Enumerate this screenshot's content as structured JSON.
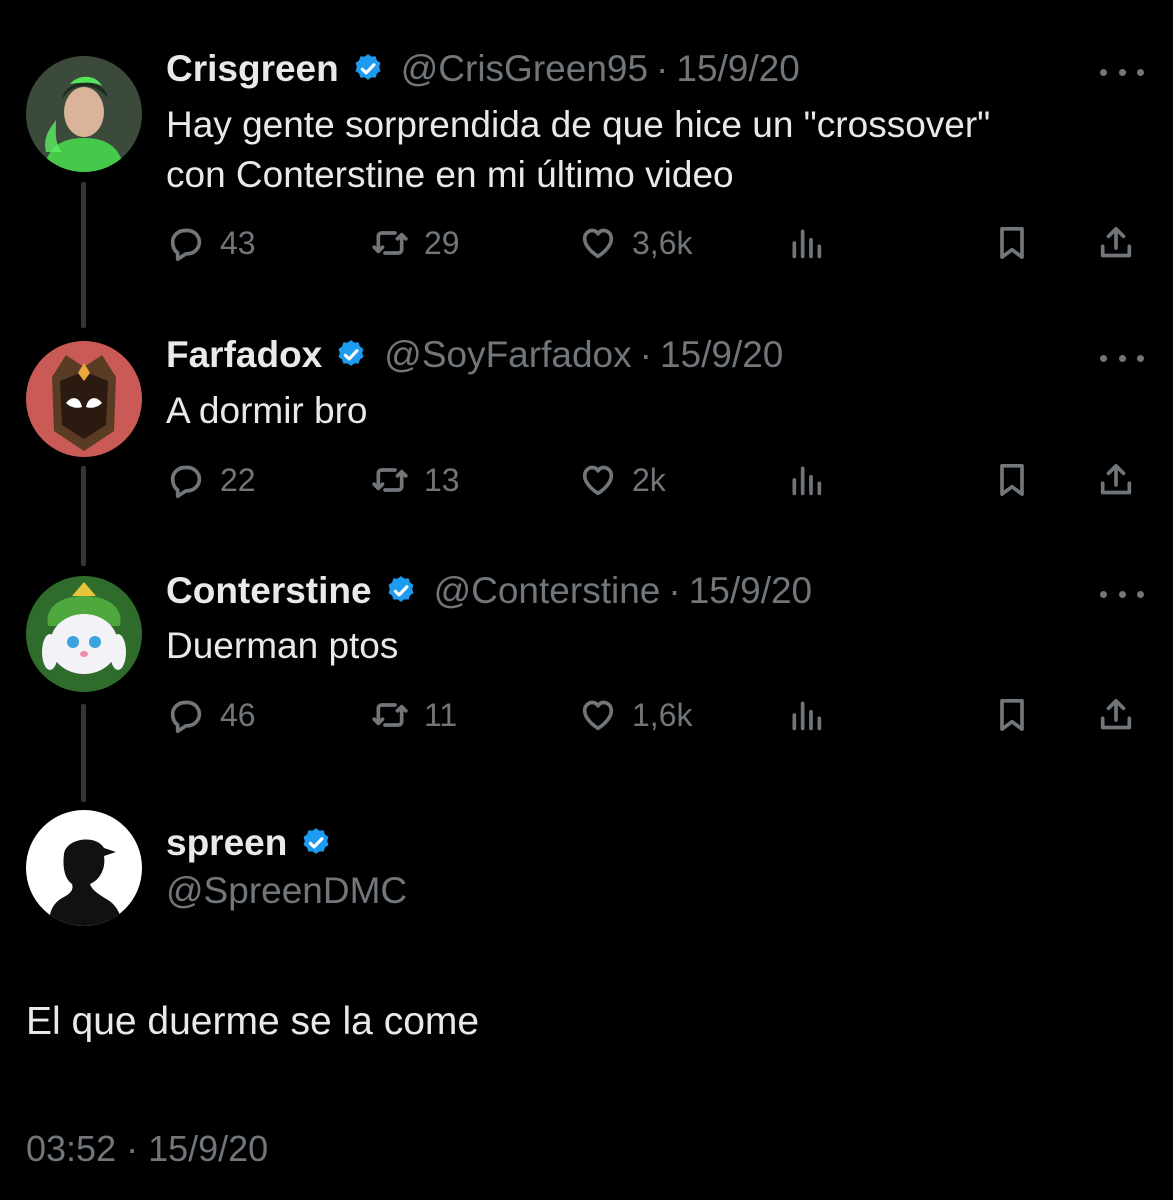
{
  "tweets": [
    {
      "name": "Crisgreen",
      "handle": "@CrisGreen95",
      "separator": "·",
      "date": "15/9/20",
      "text_lines": [
        "Hay gente sorprendida de que hice un \"crossover\"",
        "con Conterstine en mi último video"
      ],
      "replies": "43",
      "retweets": "29",
      "likes": "3,6k"
    },
    {
      "name": "Farfadox",
      "handle": "@SoyFarfadox",
      "separator": "·",
      "date": "15/9/20",
      "text_lines": [
        "A dormir bro"
      ],
      "replies": "22",
      "retweets": "13",
      "likes": "2k"
    },
    {
      "name": "Conterstine",
      "handle": "@Conterstine",
      "separator": "·",
      "date": "15/9/20",
      "text_lines": [
        "Duerman ptos"
      ],
      "replies": "46",
      "retweets": "11",
      "likes": "1,6k"
    }
  ],
  "main_tweet": {
    "name": "spreen",
    "handle": "@SpreenDMC",
    "text": "El que duerme se la come",
    "timestamp": "03:52 · 15/9/20"
  },
  "icons": {
    "verified": "verified-badge-icon",
    "reply": "reply-icon",
    "retweet": "retweet-icon",
    "like": "heart-icon",
    "views": "views-icon",
    "bookmark": "bookmark-icon",
    "share": "share-icon",
    "more": "more-icon"
  },
  "colors": {
    "background": "#000000",
    "text": "#e7e9ea",
    "secondary": "#71767b",
    "verified": "#1d9bf0"
  }
}
